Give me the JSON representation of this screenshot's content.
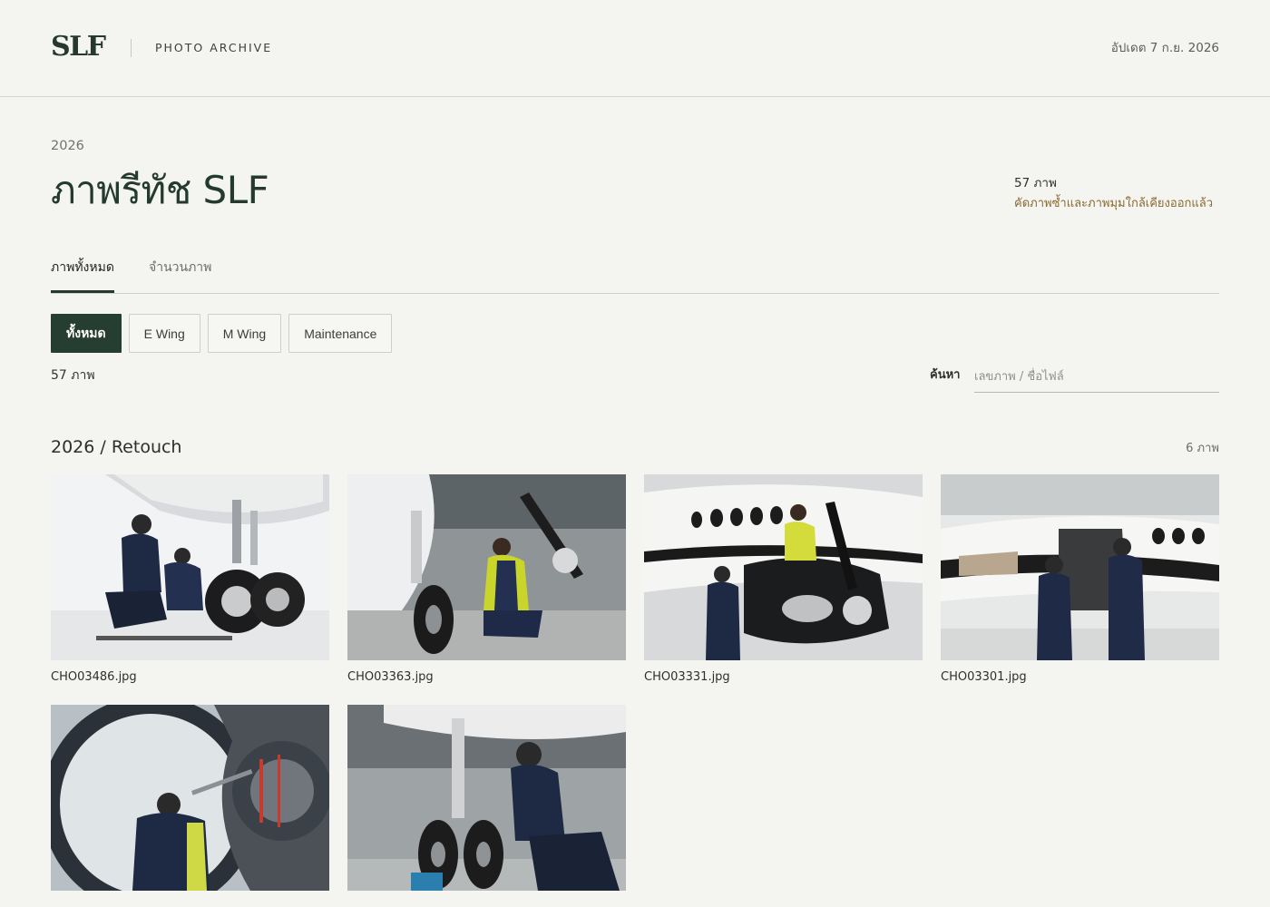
{
  "header": {
    "logo": "SLF",
    "archive_label": "PHOTO ARCHIVE",
    "updated": "อัปเดต 7 ก.ย. 2026"
  },
  "page": {
    "year": "2026",
    "title": "ภาพรีทัช SLF",
    "total_count": "57 ภาพ",
    "note": "คัดภาพซ้ำและภาพมุมใกล้เคียงออกแล้ว"
  },
  "tabs": [
    {
      "label": "ภาพทั้งหมด",
      "active": true
    },
    {
      "label": "จำนวนภาพ",
      "active": false
    }
  ],
  "filters": [
    {
      "label": "ทั้งหมด",
      "active": true
    },
    {
      "label": "E Wing",
      "active": false
    },
    {
      "label": "M Wing",
      "active": false
    },
    {
      "label": "Maintenance",
      "active": false
    }
  ],
  "results": {
    "count": "57 ภาพ"
  },
  "search": {
    "label": "ค้นหา",
    "placeholder": "เลขภาพ / ชื่อไฟล์",
    "value": ""
  },
  "section": {
    "title": "2026 / Retouch",
    "count": "6 ภาพ"
  },
  "photos": [
    {
      "filename": "CHO03486.jpg",
      "scene": "two technicians kneeling by main landing gear"
    },
    {
      "filename": "CHO03363.jpg",
      "scene": "technician servicing nose gear in hangar"
    },
    {
      "filename": "CHO03331.jpg",
      "scene": "technicians working on propeller engine"
    },
    {
      "filename": "CHO03301.jpg",
      "scene": "technicians inspecting engine nacelle"
    },
    {
      "filename": "",
      "scene": "technician inside jet engine cowling"
    },
    {
      "filename": "",
      "scene": "technician servicing nose wheel"
    }
  ],
  "colors": {
    "background": "#f4f4f1",
    "brand_dark_green": "#263d31",
    "note_brown": "#8a6a2f"
  }
}
